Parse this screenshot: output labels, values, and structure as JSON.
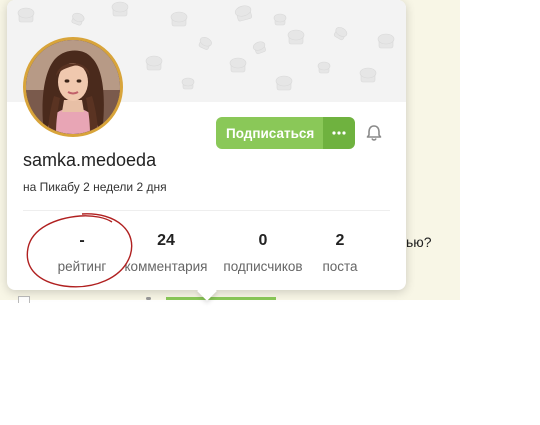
{
  "profile": {
    "username": "samka.medoeda",
    "since": "на Пикабу 2 недели 2 дня",
    "subscribe_label": "Подписаться",
    "more_icon": "dots-horizontal-icon",
    "bell_icon": "bell-icon"
  },
  "stats": [
    {
      "value": "-",
      "label": "рейтинг"
    },
    {
      "value": "24",
      "label": "комментария"
    },
    {
      "value": "0",
      "label": "подписчиков"
    },
    {
      "value": "2",
      "label": "поста"
    }
  ],
  "background": {
    "partial_text": "ью?"
  },
  "colors": {
    "accent_green": "#8ac858",
    "accent_green_dark": "#6fb23f",
    "avatar_ring": "#d8a43a",
    "annotation_red": "#b02020"
  }
}
